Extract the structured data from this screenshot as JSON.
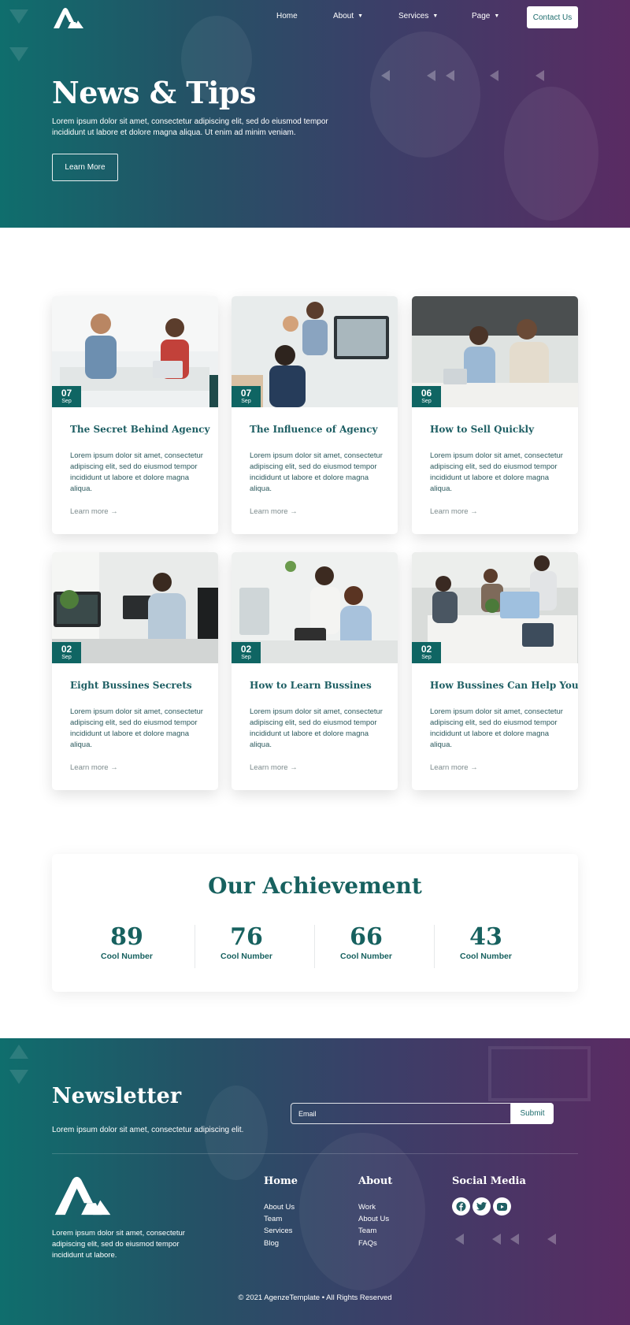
{
  "header": {
    "nav": [
      {
        "label": "Home"
      },
      {
        "label": "About"
      },
      {
        "label": "Services"
      },
      {
        "label": "Page"
      }
    ],
    "contact_label": "Contact Us"
  },
  "hero": {
    "title": "News & Tips",
    "text": "Lorem ipsum dolor sit amet, consectetur adipiscing elit, sed do eiusmod tempor incididunt ut labore et dolore magna aliqua. Ut enim ad minim veniam.",
    "button": "Learn More"
  },
  "posts": [
    {
      "day": "07",
      "month": "Sep",
      "title": "The Secret Behind Agency",
      "text": "Lorem ipsum dolor sit amet, consectetur adipiscing elit, sed do eiusmod tempor incididunt ut labore et dolore magna aliqua.",
      "link": "Learn more →"
    },
    {
      "day": "07",
      "month": "Sep",
      "title": "The Influence of Agency",
      "text": "Lorem ipsum dolor sit amet, consectetur adipiscing elit, sed do eiusmod tempor incididunt ut labore et dolore magna aliqua.",
      "link": "Learn more →"
    },
    {
      "day": "06",
      "month": "Sep",
      "title": "How to Sell Quickly",
      "text": "Lorem ipsum dolor sit amet, consectetur adipiscing elit, sed do eiusmod tempor incididunt ut labore et dolore magna aliqua.",
      "link": "Learn more →"
    },
    {
      "day": "02",
      "month": "Sep",
      "title": "Eight Bussines Secrets",
      "text": "Lorem ipsum dolor sit amet, consectetur adipiscing elit, sed do eiusmod tempor incididunt ut labore et dolore magna aliqua.",
      "link": "Learn more →"
    },
    {
      "day": "02",
      "month": "Sep",
      "title": "How to Learn Bussines",
      "text": "Lorem ipsum dolor sit amet, consectetur adipiscing elit, sed do eiusmod tempor incididunt ut labore et dolore magna aliqua.",
      "link": "Learn more →"
    },
    {
      "day": "02",
      "month": "Sep",
      "title": "How Bussines Can Help You",
      "text": "Lorem ipsum dolor sit amet, consectetur adipiscing elit, sed do eiusmod tempor incididunt ut labore et dolore magna aliqua.",
      "link": "Learn more →"
    }
  ],
  "achievement": {
    "title": "Our Achievement",
    "stats": [
      {
        "value": "89",
        "label": "Cool Number"
      },
      {
        "value": "76",
        "label": "Cool Number"
      },
      {
        "value": "66",
        "label": "Cool Number"
      },
      {
        "value": "43",
        "label": "Cool Number"
      }
    ]
  },
  "newsletter": {
    "title": "Newsletter",
    "text": "Lorem ipsum dolor sit amet, consectetur adipiscing elit.",
    "placeholder": "Email",
    "submit": "Submit"
  },
  "footer": {
    "about": "Lorem ipsum dolor sit amet, consectetur adipiscing elit, sed do eiusmod tempor incididunt ut labore.",
    "col1": {
      "title": "Home",
      "links": [
        "About Us",
        "Team",
        "Services",
        "Blog"
      ]
    },
    "col2": {
      "title": "About",
      "links": [
        "Work",
        "About Us",
        "Team",
        "FAQs"
      ]
    },
    "social_title": "Social Media",
    "social_icons": [
      "facebook-icon",
      "twitter-icon",
      "youtube-icon"
    ],
    "copyright": "© 2021 AgenzeTemplate • All Rights Reserved"
  },
  "colors": {
    "primary": "#0f6563",
    "gradient_start": "#0f6e6d",
    "gradient_end": "#5a2b63"
  }
}
